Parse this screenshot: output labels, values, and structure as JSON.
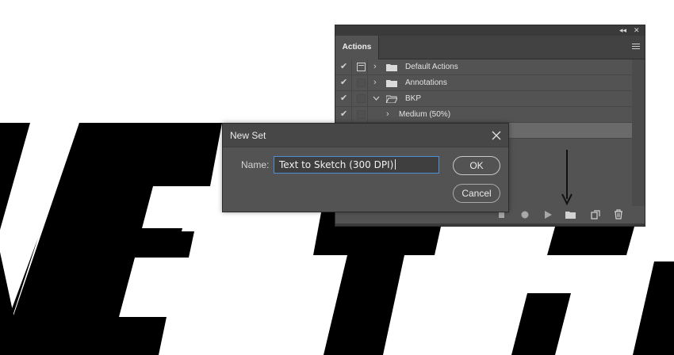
{
  "actions_panel": {
    "collapse_glyph": "◂◂",
    "close_glyph": "✕",
    "tab_label": "Actions",
    "menu_icon": "panel-menu-icon",
    "rows": [
      {
        "label": "Default Actions",
        "checked": true,
        "dialog_toggle": true,
        "expanded": false,
        "type": "set"
      },
      {
        "label": "Annotations",
        "checked": true,
        "dialog_toggle": false,
        "expanded": false,
        "type": "set"
      },
      {
        "label": "BKP",
        "checked": true,
        "dialog_toggle": false,
        "expanded": true,
        "type": "set"
      },
      {
        "label": "Medium (50%)",
        "checked": true,
        "dialog_toggle": false,
        "expanded": false,
        "type": "action"
      },
      {
        "label": "",
        "checked": false,
        "dialog_toggle": false,
        "expanded": false,
        "type": "selected"
      }
    ],
    "bottom_toolbar": [
      "stop-icon",
      "record-icon",
      "play-icon",
      "new-set-folder-icon",
      "new-action-icon",
      "delete-icon"
    ]
  },
  "dialog": {
    "title": "New Set",
    "name_label": "Name:",
    "name_value": "Text to Sketch (300 DPI)",
    "ok_label": "OK",
    "cancel_label": "Cancel"
  },
  "colors": {
    "panel_bg": "#535353",
    "input_focus": "#4e8fd6",
    "canvas_bg": "#ffffff",
    "artwork": "#000000"
  }
}
